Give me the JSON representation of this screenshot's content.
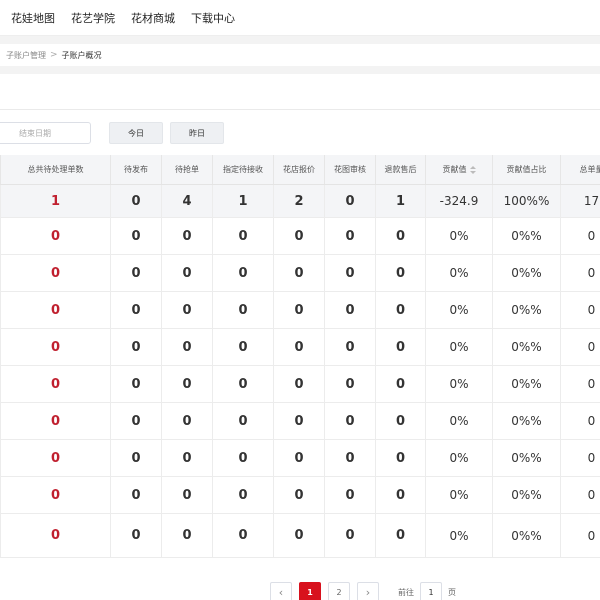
{
  "nav": {
    "items": [
      "花娃地图",
      "花艺学院",
      "花材商城",
      "下载中心"
    ]
  },
  "breadcrumb": {
    "parent": "子账户管理",
    "separator": ">",
    "current": "子账户概况"
  },
  "filters": {
    "end_date_placeholder": "结束日期",
    "today": "今日",
    "yesterday": "昨日"
  },
  "table": {
    "headers": [
      "总共待处理单数",
      "待发布",
      "待抢单",
      "指定待接收",
      "花店报价",
      "花图审核",
      "退款售后",
      "贡献值",
      "贡献值占比",
      "总单量"
    ],
    "sortable_header": "贡献值",
    "summary": [
      "1",
      "0",
      "4",
      "1",
      "2",
      "0",
      "1",
      "-324.9",
      "100%%",
      "17"
    ],
    "rows": [
      [
        "0",
        "0",
        "0",
        "0",
        "0",
        "0",
        "0",
        "0%",
        "0%%",
        "0"
      ],
      [
        "0",
        "0",
        "0",
        "0",
        "0",
        "0",
        "0",
        "0%",
        "0%%",
        "0"
      ],
      [
        "0",
        "0",
        "0",
        "0",
        "0",
        "0",
        "0",
        "0%",
        "0%%",
        "0"
      ],
      [
        "0",
        "0",
        "0",
        "0",
        "0",
        "0",
        "0",
        "0%",
        "0%%",
        "0"
      ],
      [
        "0",
        "0",
        "0",
        "0",
        "0",
        "0",
        "0",
        "0%",
        "0%%",
        "0"
      ],
      [
        "0",
        "0",
        "0",
        "0",
        "0",
        "0",
        "0",
        "0%",
        "0%%",
        "0"
      ],
      [
        "0",
        "0",
        "0",
        "0",
        "0",
        "0",
        "0",
        "0%",
        "0%%",
        "0"
      ],
      [
        "0",
        "0",
        "0",
        "0",
        "0",
        "0",
        "0",
        "0%",
        "0%%",
        "0"
      ],
      [
        "0",
        "0",
        "0",
        "0",
        "0",
        "0",
        "0",
        "0%",
        "0%%",
        "0"
      ]
    ]
  },
  "pagination": {
    "prev_icon": "chevron-left-icon",
    "next_icon": "chevron-right-icon",
    "pages": [
      "1",
      "2"
    ],
    "active_page": "1",
    "goto_label": "前往",
    "goto_value": "1",
    "unit": "页"
  },
  "colors": {
    "accent_red": "#d8111d",
    "highlight_text_red": "#c0202f"
  }
}
